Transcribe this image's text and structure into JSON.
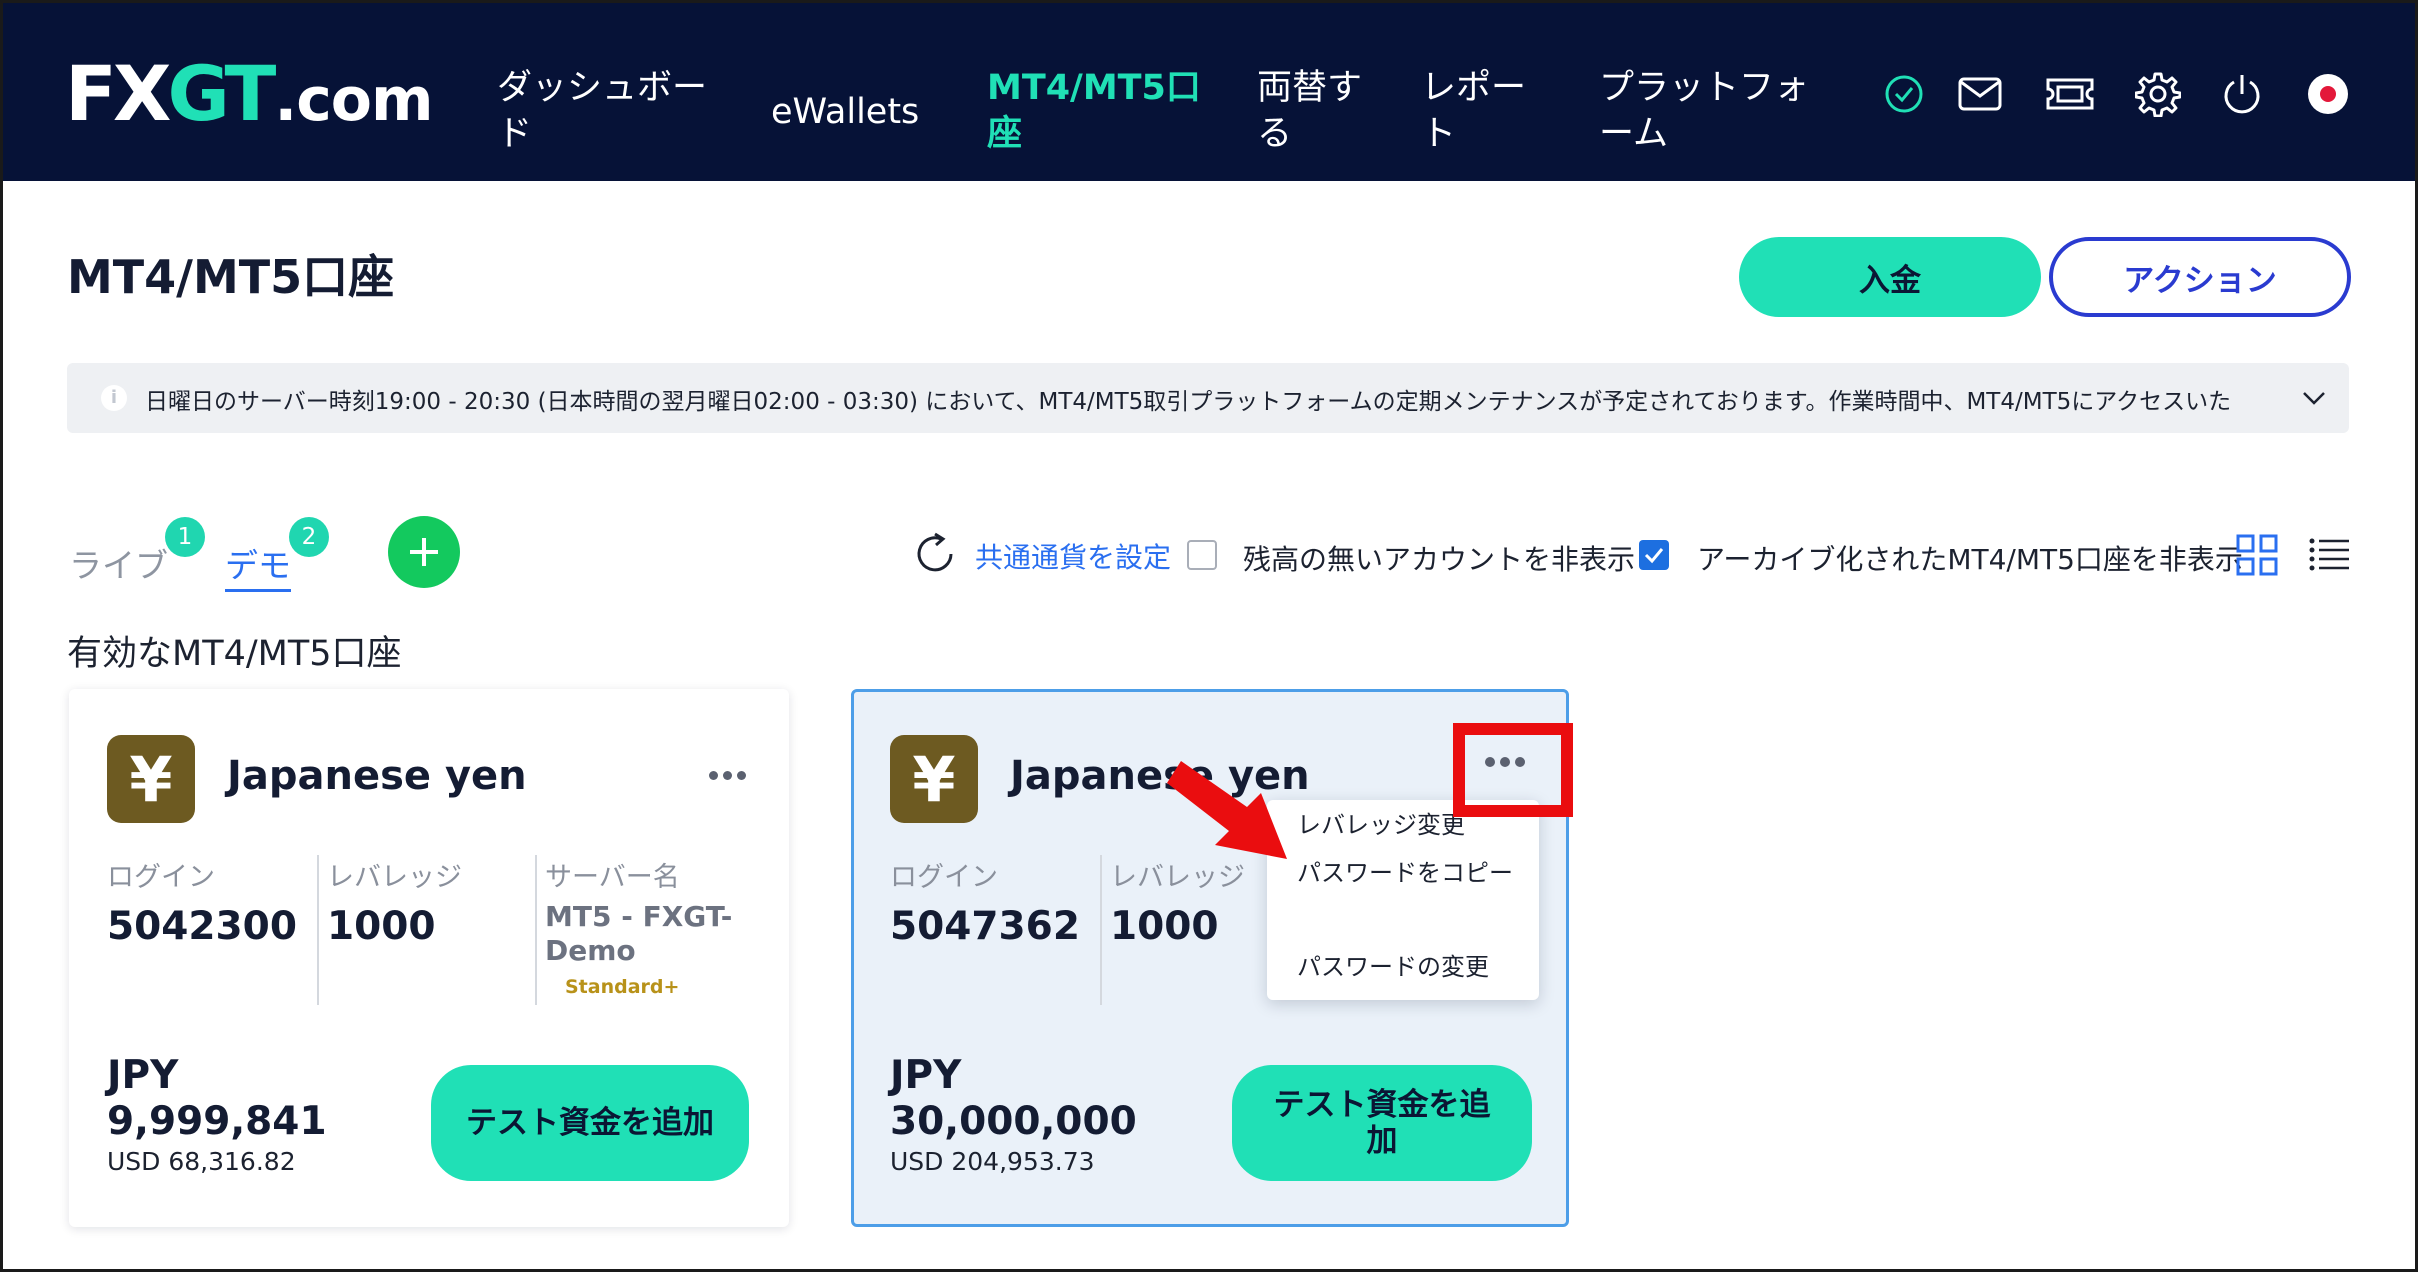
{
  "brand": {
    "fx": "FX",
    "gt": "GT",
    "com": ".com"
  },
  "nav": [
    {
      "label": "ダッシュボード"
    },
    {
      "label": "eWallets"
    },
    {
      "label": "MT4/MT5口座"
    },
    {
      "label": "両替する"
    },
    {
      "label": "レポート"
    },
    {
      "label": "プラットフォーム"
    }
  ],
  "top_icons": [
    "verified-check-icon",
    "mail-icon",
    "ticket-icon",
    "settings-gear-icon",
    "power-icon",
    "japan-flag-icon"
  ],
  "page": {
    "title": "MT4/MT5口座",
    "deposit_label": "入金",
    "action_label": "アクション"
  },
  "notice": {
    "text": "日曜日のサーバー時刻19:00 - 20:30 (日本時間の翌月曜日02:00 - 03:30) において、MT4/MT5取引プラットフォームの定期メンテナンスが予定されております。作業時間中、MT4/MT5にアクセスいた"
  },
  "tabs": [
    {
      "label": "ライブ",
      "count": "1"
    },
    {
      "label": "デモ",
      "count": "2"
    }
  ],
  "filters": {
    "set_currency": "共通通貨を設定",
    "hide_zero": "残高の無いアカウントを非表示",
    "hide_archived": "アーカイブ化されたMT4/MT5口座を非表示"
  },
  "section_title": "有効なMT4/MT5口座",
  "accounts": [
    {
      "name": "Japanese yen",
      "login_label": "ログイン",
      "login": "5042300",
      "leverage_label": "レバレッジ",
      "leverage": "1000",
      "server_label": "サーバー名",
      "server": "MT5 - FXGT-Demo",
      "server_type": "Standard+",
      "currency": "JPY",
      "balance": "9,999,841",
      "usd": "USD 68,316.82",
      "button": "テスト資金を追加"
    },
    {
      "name": "Japanese yen",
      "login_label": "ログイン",
      "login": "5047362",
      "leverage_label": "レバレッジ",
      "leverage": "1000",
      "currency": "JPY",
      "balance": "30,000,000",
      "usd": "USD 204,953.73",
      "button": "テスト資金を追加"
    }
  ],
  "dropdown": [
    {
      "label": "レバレッジ変更"
    },
    {
      "label": "パスワードをコピー"
    },
    {
      "label": "パスワードの変更"
    }
  ],
  "colors": {
    "navbar": "#061237",
    "accent": "#20e0b6",
    "link": "#2a6ff0",
    "annotation": "#ea0d0f"
  }
}
